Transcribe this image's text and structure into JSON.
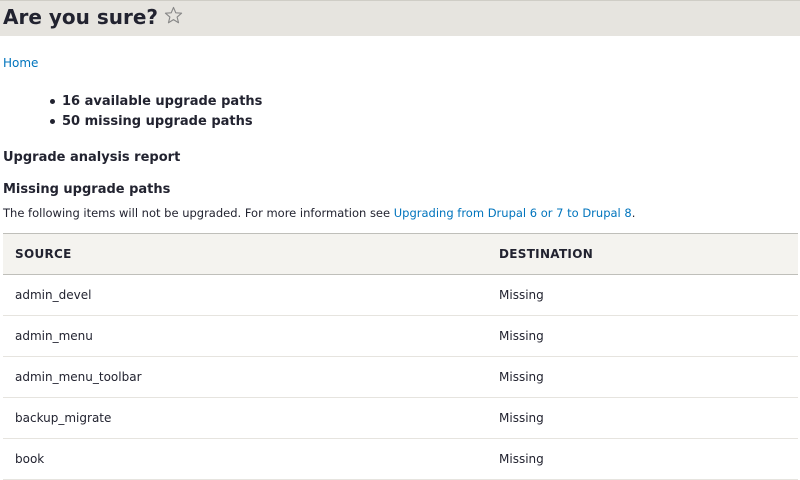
{
  "header": {
    "title": "Are you sure?",
    "shortcut_icon": "star-outline-icon"
  },
  "breadcrumb": {
    "home": "Home"
  },
  "summary": [
    "16 available upgrade paths",
    "50 missing upgrade paths"
  ],
  "report": {
    "heading": "Upgrade analysis report",
    "missing_heading": "Missing upgrade paths",
    "info_text": "The following items will not be upgraded. For more information see ",
    "info_link": "Upgrading from Drupal 6 or 7 to Drupal 8",
    "info_end": "."
  },
  "table": {
    "headers": [
      "SOURCE",
      "DESTINATION"
    ],
    "rows": [
      {
        "source": "admin_devel",
        "destination": "Missing"
      },
      {
        "source": "admin_menu",
        "destination": "Missing"
      },
      {
        "source": "admin_menu_toolbar",
        "destination": "Missing"
      },
      {
        "source": "backup_migrate",
        "destination": "Missing"
      },
      {
        "source": "book",
        "destination": "Missing"
      }
    ]
  },
  "colors": {
    "header_bg": "#e6e4df",
    "link": "#0074bd",
    "text": "#222330",
    "table_head_bg": "#f4f3ef"
  }
}
